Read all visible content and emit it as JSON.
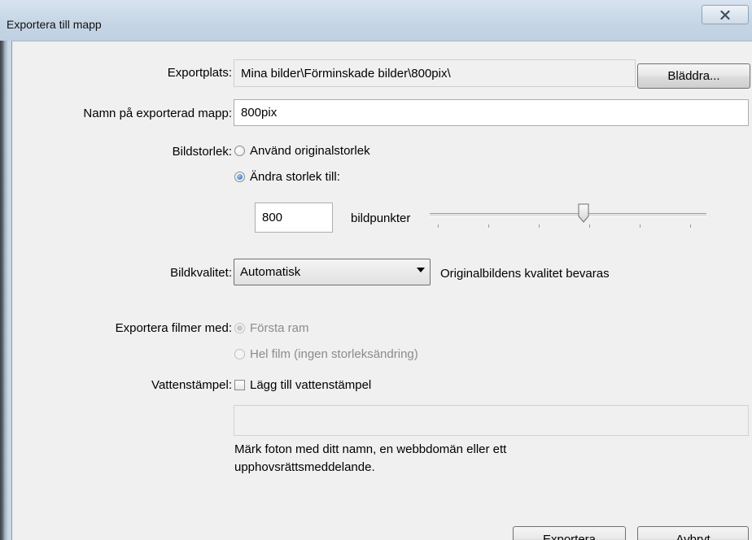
{
  "window": {
    "title": "Exportera till mapp",
    "close_label": "X"
  },
  "export_location": {
    "label": "Exportplats:",
    "value": "Mina bilder\\Förminskade bilder\\800pix\\",
    "browse_label": "Bläddra..."
  },
  "folder_name": {
    "label": "Namn på exporterad mapp:",
    "value": "800pix"
  },
  "image_size": {
    "label": "Bildstorlek:",
    "options": [
      {
        "label": "Använd originalstorlek",
        "selected": false
      },
      {
        "label": "Ändra storlek till:",
        "selected": true
      }
    ],
    "pixels_value": "800",
    "pixels_unit": "bildpunkter",
    "slider_fraction": 0.56
  },
  "image_quality": {
    "label": "Bildkvalitet:",
    "selected": "Automatisk",
    "note": "Originalbildens kvalitet bevaras"
  },
  "export_videos": {
    "label": "Exportera filmer med:",
    "options": [
      {
        "label": "Första ram",
        "selected": true
      },
      {
        "label": "Hel film (ingen storleksändring)",
        "selected": false
      }
    ]
  },
  "watermark": {
    "label": "Vattenstämpel:",
    "checkbox_label": "Lägg till vattenstämpel",
    "checked": false,
    "text_value": "",
    "hint_line1": "Märk foton med ditt namn, en webbdomän eller ett",
    "hint_line2": "upphovsrättsmeddelande."
  },
  "buttons": {
    "export_label": "Exportera",
    "cancel_label": "Avbryt"
  }
}
